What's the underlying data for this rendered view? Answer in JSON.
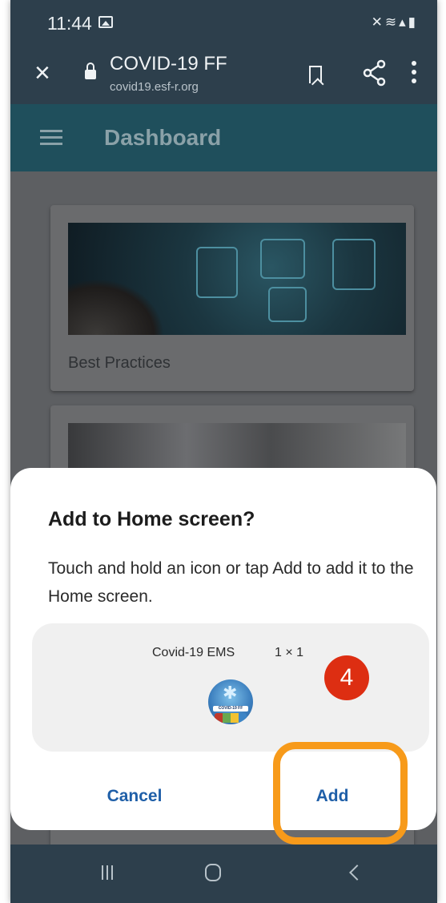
{
  "status_bar": {
    "time": "11:44",
    "icons": [
      "gallery-icon",
      "mute-icon",
      "wifi-icon",
      "signal-icon",
      "battery-icon"
    ]
  },
  "browser": {
    "close_icon": "close-icon",
    "site_title": "COVID-19 FF",
    "site_url": "covid19.esf-r.org",
    "actions": [
      "bookmark-icon",
      "share-icon",
      "more-icon"
    ]
  },
  "app_bar": {
    "title": "Dashboard",
    "menu_icon": "hamburger-icon"
  },
  "cards": [
    {
      "caption": "Best Practices"
    },
    {
      "caption": ""
    }
  ],
  "dialog": {
    "title": "Add to Home screen?",
    "body": "Touch and hold an icon or tap Add to add it to the Home screen.",
    "preview": {
      "app_name": "Covid-19 EMS",
      "size": "1 × 1",
      "icon_band_text": "COVID-19 FF"
    },
    "cancel_label": "Cancel",
    "add_label": "Add"
  },
  "annotation": {
    "step_number": "4",
    "highlight_color": "#f79a1a",
    "badge_color": "#dd2e12"
  },
  "nav": [
    "recent-apps-icon",
    "home-icon",
    "back-icon"
  ],
  "colors": {
    "status_bg": "#2d3f4c",
    "appbar_bg": "#1f4f5c",
    "accent_text": "#1f5fa8"
  }
}
